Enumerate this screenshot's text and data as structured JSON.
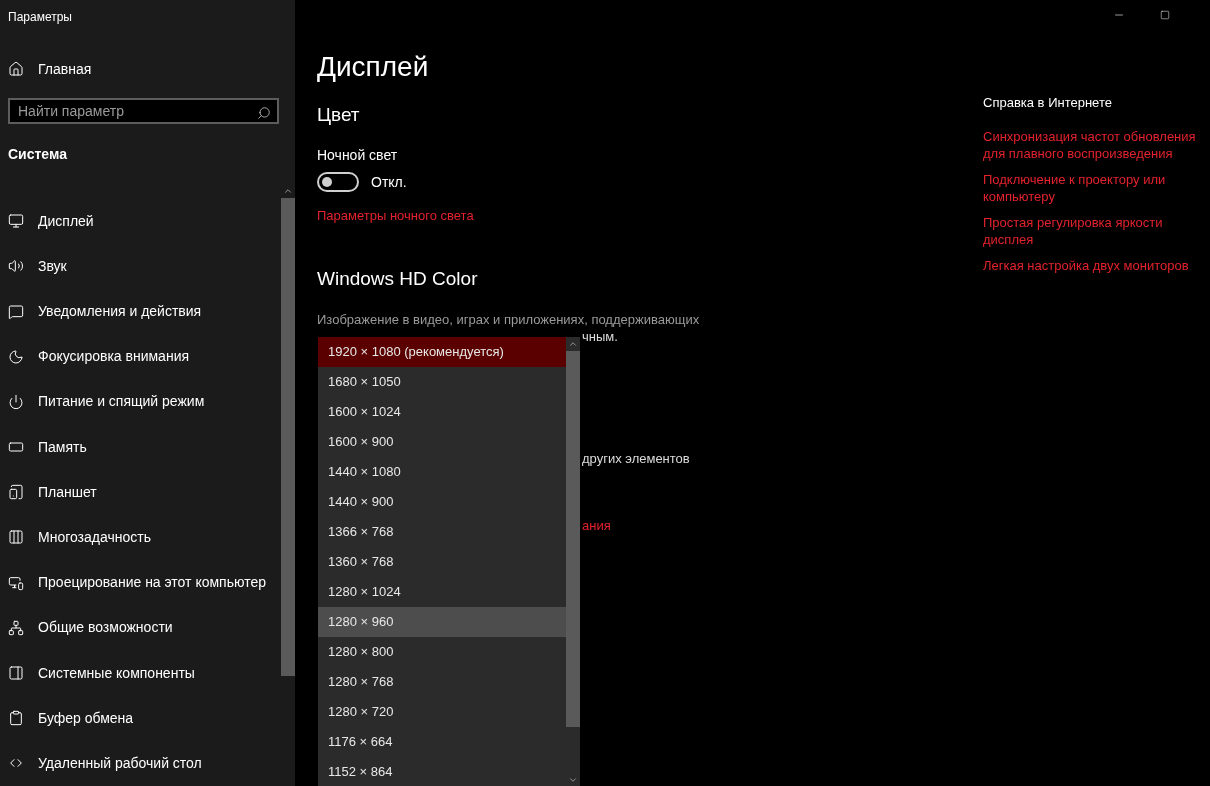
{
  "window": {
    "title": "Параметры"
  },
  "sidebar": {
    "home": "Главная",
    "search": {
      "placeholder": "Найти параметр"
    },
    "section": "Система",
    "items": [
      {
        "label": "Дисплей"
      },
      {
        "label": "Звук"
      },
      {
        "label": "Уведомления и действия"
      },
      {
        "label": "Фокусировка внимания"
      },
      {
        "label": "Питание и спящий режим"
      },
      {
        "label": "Память"
      },
      {
        "label": "Планшет"
      },
      {
        "label": "Многозадачность"
      },
      {
        "label": "Проецирование на этот компьютер"
      },
      {
        "label": "Общие возможности"
      },
      {
        "label": "Системные компоненты"
      },
      {
        "label": "Буфер обмена"
      },
      {
        "label": "Удаленный рабочий стол"
      }
    ]
  },
  "main": {
    "title": "Дисплей",
    "color_heading": "Цвет",
    "night_light": {
      "label": "Ночной свет",
      "on": false,
      "state_text": "Откл."
    },
    "night_light_link": "Параметры ночного света",
    "hd_heading": "Windows HD Color",
    "hd_text": "Изображение в видео, играх и приложениях, поддерживающих",
    "covered_fragments": [
      {
        "kind": "text",
        "text": "чным."
      },
      {
        "kind": "text",
        "text": "других элементов"
      },
      {
        "kind": "link",
        "text": "ания"
      }
    ]
  },
  "resolution_dropdown": {
    "options": [
      {
        "label": "1920 × 1080 (рекомендуется)",
        "selected": true,
        "hovered": false
      },
      {
        "label": "1680 × 1050",
        "selected": false,
        "hovered": false
      },
      {
        "label": "1600 × 1024",
        "selected": false,
        "hovered": false
      },
      {
        "label": "1600 × 900",
        "selected": false,
        "hovered": false
      },
      {
        "label": "1440 × 1080",
        "selected": false,
        "hovered": false
      },
      {
        "label": "1440 × 900",
        "selected": false,
        "hovered": false
      },
      {
        "label": "1366 × 768",
        "selected": false,
        "hovered": false
      },
      {
        "label": "1360 × 768",
        "selected": false,
        "hovered": false
      },
      {
        "label": "1280 × 1024",
        "selected": false,
        "hovered": false
      },
      {
        "label": "1280 × 960",
        "selected": false,
        "hovered": true
      },
      {
        "label": "1280 × 800",
        "selected": false,
        "hovered": false
      },
      {
        "label": "1280 × 768",
        "selected": false,
        "hovered": false
      },
      {
        "label": "1280 × 720",
        "selected": false,
        "hovered": false
      },
      {
        "label": "1176 × 664",
        "selected": false,
        "hovered": false
      },
      {
        "label": "1152 × 864",
        "selected": false,
        "hovered": false
      }
    ]
  },
  "help": {
    "heading": "Справка в Интернете",
    "links": [
      "Синхронизация частот обновления для плавного воспроизведения",
      "Подключение к проектору или компьютеру",
      "Простая регулировка яркости дисплея",
      "Легкая настройка двух мониторов"
    ]
  }
}
